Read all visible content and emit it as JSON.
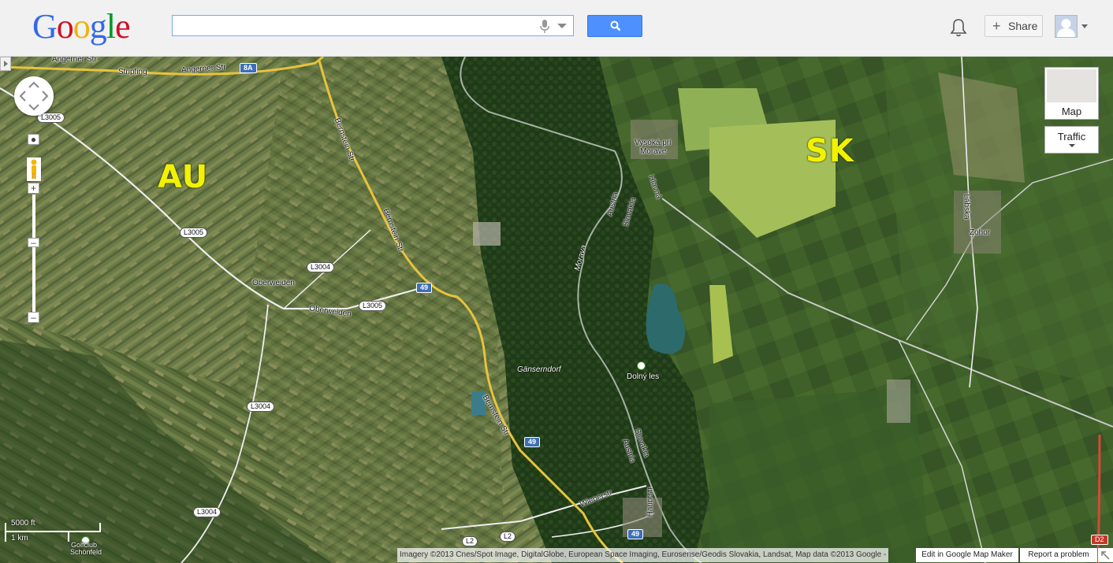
{
  "header": {
    "logo_letters": [
      "G",
      "o",
      "o",
      "g",
      "l",
      "e"
    ],
    "logo_colors": [
      "#3369e8",
      "#d50f25",
      "#eeb211",
      "#3369e8",
      "#009925",
      "#d50f25"
    ],
    "search_value": "",
    "share_label": "Share"
  },
  "layers": {
    "map_label": "Map",
    "traffic_label": "Traffic"
  },
  "map": {
    "country_left": "AU",
    "country_right": "SK",
    "road_labels": {
      "angerner_str_1": "Angerner Str",
      "stripfing": "Stripfing",
      "angerner_str_2": "Angerner Str",
      "bernstein_str_1": "Bernstein Str",
      "bernstein_str_2": "Bernstein Str",
      "bernstein_str_3": "Bernstein Str",
      "oberweiden_1": "Oberweiden",
      "oberweiden_2": "Oberweiden",
      "wienerstr": "Wienerstr",
      "hauptstr": "Hauptstr",
      "hlavna": "Hlavná",
      "labska": "Lábska",
      "austria_slovakia_1a": "Austria",
      "austria_slovakia_1b": "Slovakia",
      "austria_slovakia_2a": "Slovakia",
      "austria_slovakia_2b": "Austria",
      "morava": "Morava",
      "ganserndorf": "Gänserndorf",
      "vysoka": "Vysoká pri",
      "vysoka2": "Morave",
      "zohor": "Zohor",
      "dolny_les": "Dolný les",
      "golfclub1": "Golfclub",
      "golfclub2": "Schönfeld"
    },
    "shields": {
      "s8a": "8A",
      "l3005a": "L3005",
      "l3005b": "L3005",
      "l3005c": "L3005",
      "l3004a": "L3004",
      "l3004b": "L3004",
      "l3004c": "L3004",
      "r49a": "49",
      "r49b": "49",
      "r49c": "49",
      "l2a": "L2",
      "l2b": "L2",
      "d2": "D2"
    }
  },
  "scale": {
    "ft": "5000 ft",
    "km": "1 km"
  },
  "footer": {
    "attribution": "Imagery ©2013 Cnes/Spot Image, DigitalGlobe, European Space Imaging, Eurosense/Geodis Slovakia, Landsat, Map data ©2013 Google -",
    "edit_link": "Edit in Google Map Maker",
    "report_link": "Report a problem"
  },
  "colors": {
    "search_button": "#4d90fe",
    "country_label": "#f2f200",
    "road_yellow": "#e8c33c"
  }
}
